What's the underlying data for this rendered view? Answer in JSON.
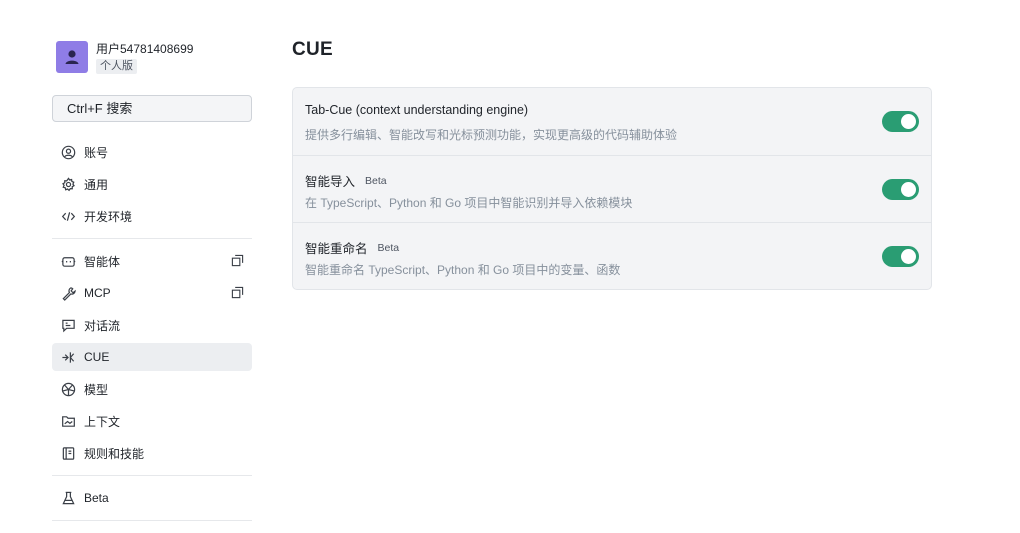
{
  "user": {
    "name": "用户54781408699",
    "plan": "个人版"
  },
  "search": {
    "label": "Ctrl+F 搜索"
  },
  "nav": {
    "account": "账号",
    "general": "通用",
    "dev_env": "开发环境",
    "agents": "智能体",
    "mcp": "MCP",
    "conversation": "对话流",
    "cue": "CUE",
    "models": "模型",
    "context": "上下文",
    "rules_skills": "规则和技能",
    "beta": "Beta"
  },
  "main": {
    "title": "CUE",
    "rows": [
      {
        "title": "Tab-Cue (context understanding engine)",
        "badge": "",
        "desc": "提供多行编辑、智能改写和光标预测功能，实现更高级的代码辅助体验",
        "enabled": true
      },
      {
        "title": "智能导入",
        "badge": "Beta",
        "desc": "在 TypeScript、Python 和 Go 项目中智能识别并导入依赖模块",
        "enabled": true
      },
      {
        "title": "智能重命名",
        "badge": "Beta",
        "desc": "智能重命名 TypeScript、Python 和 Go 项目中的变量、函数",
        "enabled": true
      }
    ]
  },
  "colors": {
    "accent_toggle": "#2a9d73",
    "avatar": "#8f7de6",
    "active_bg": "#eceef1"
  }
}
